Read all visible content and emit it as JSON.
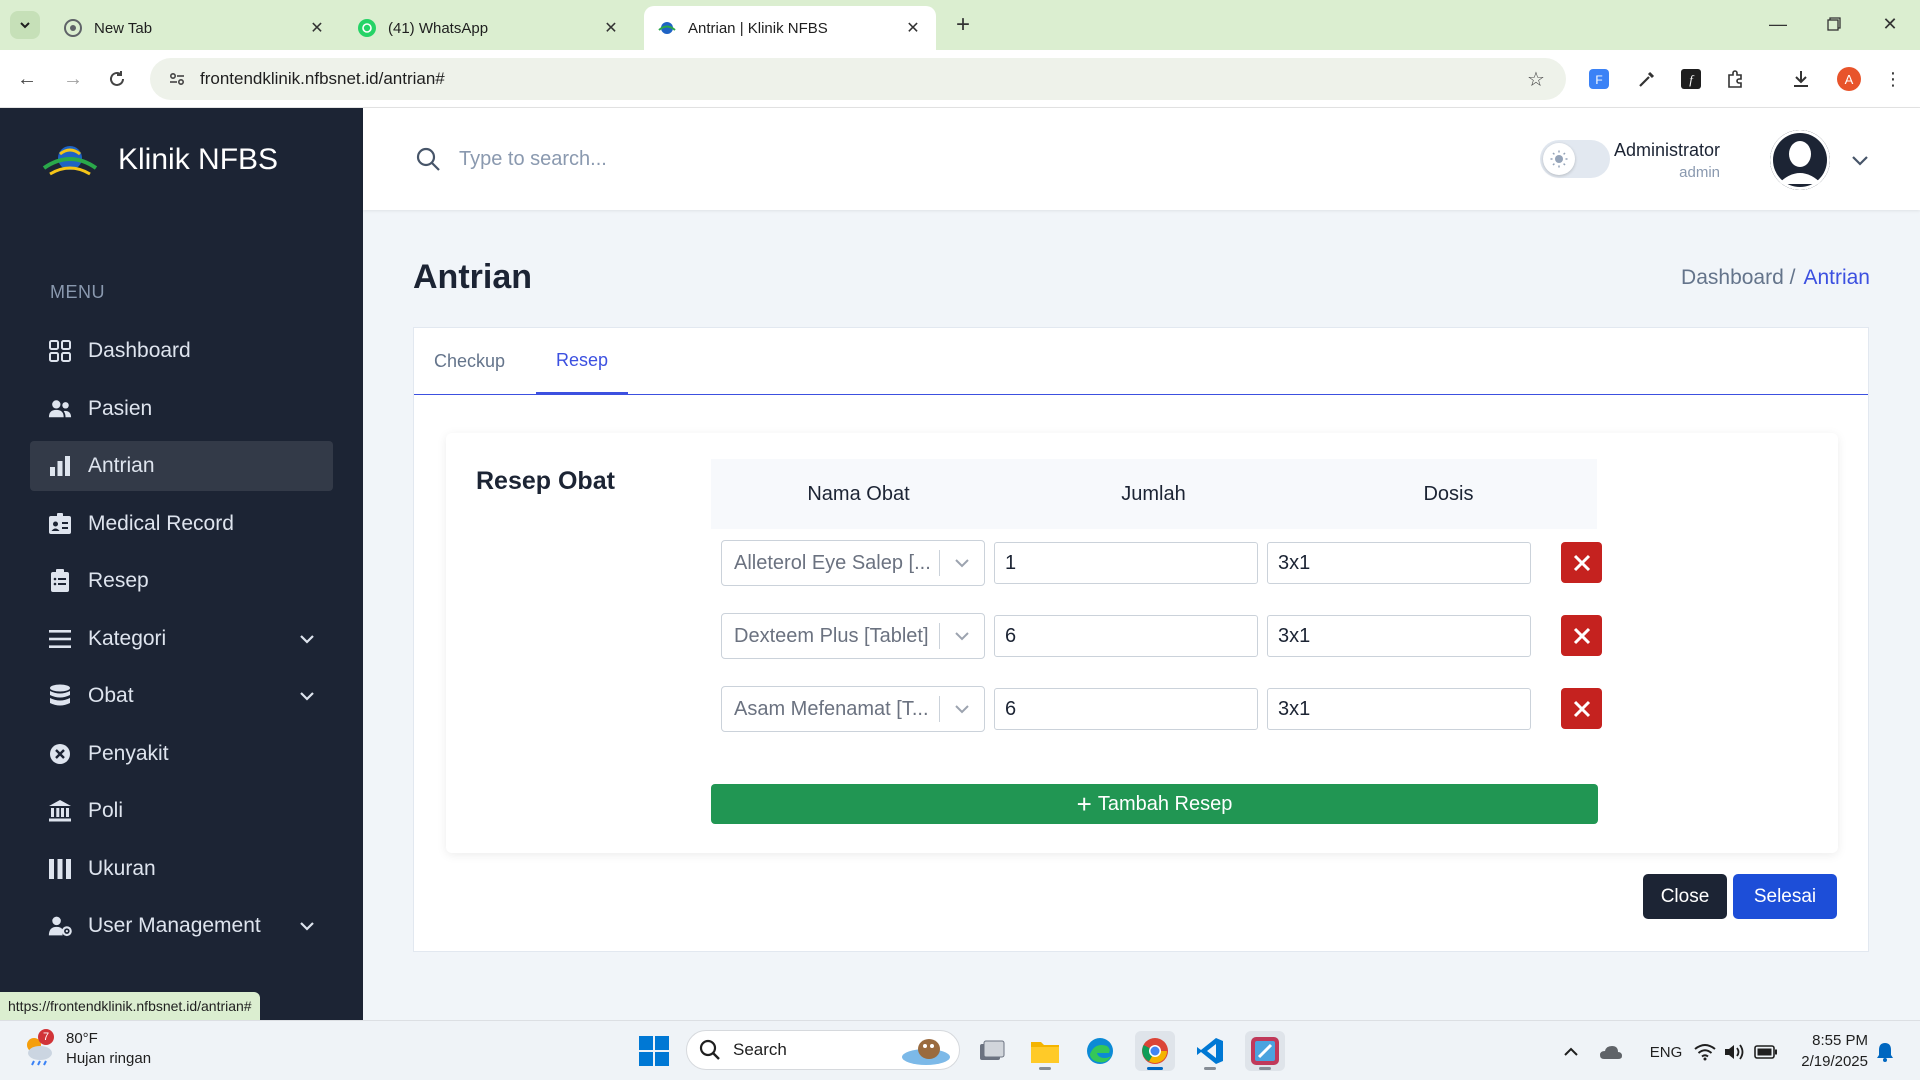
{
  "browser": {
    "tabs": [
      {
        "title": "New Tab",
        "active": false
      },
      {
        "title": "(41) WhatsApp",
        "active": false
      },
      {
        "title": "Antrian | Klinik NFBS",
        "active": true
      }
    ],
    "url": "frontendklinik.nfbsnet.id/antrian#",
    "status_url": "https://frontendklinik.nfbsnet.id/antrian#",
    "profile_initial": "A"
  },
  "sidebar": {
    "brand": "Klinik NFBS",
    "menu_heading": "MENU",
    "items": [
      {
        "label": "Dashboard",
        "icon": "grid-icon",
        "active": false,
        "chevron": false
      },
      {
        "label": "Pasien",
        "icon": "users-icon",
        "active": false,
        "chevron": false
      },
      {
        "label": "Antrian",
        "icon": "bar-chart-icon",
        "active": true,
        "chevron": false
      },
      {
        "label": "Medical Record",
        "icon": "id-card-icon",
        "active": false,
        "chevron": false
      },
      {
        "label": "Resep",
        "icon": "clipboard-icon",
        "active": false,
        "chevron": false
      },
      {
        "label": "Kategori",
        "icon": "list-icon",
        "active": false,
        "chevron": true
      },
      {
        "label": "Obat",
        "icon": "database-icon",
        "active": false,
        "chevron": true
      },
      {
        "label": "Penyakit",
        "icon": "x-circle-icon",
        "active": false,
        "chevron": false
      },
      {
        "label": "Poli",
        "icon": "building-icon",
        "active": false,
        "chevron": false
      },
      {
        "label": "Ukuran",
        "icon": "columns-icon",
        "active": false,
        "chevron": false
      },
      {
        "label": "User Management",
        "icon": "user-gear-icon",
        "active": false,
        "chevron": true
      }
    ]
  },
  "header": {
    "search_placeholder": "Type to search...",
    "user_name": "Administrator",
    "user_role": "admin"
  },
  "page": {
    "title": "Antrian",
    "breadcrumb": {
      "parent": "Dashboard /",
      "current": "Antrian"
    },
    "tabs": [
      {
        "label": "Checkup",
        "active": false
      },
      {
        "label": "Resep",
        "active": true
      }
    ],
    "resep": {
      "title": "Resep Obat",
      "columns": [
        "Nama Obat",
        "Jumlah",
        "Dosis"
      ],
      "rows": [
        {
          "obat": "Alleterol Eye Salep [...",
          "jumlah": "1",
          "dosis": "3x1"
        },
        {
          "obat": "Dexteem Plus [Tablet]",
          "jumlah": "6",
          "dosis": "3x1"
        },
        {
          "obat": "Asam Mefenamat [T...",
          "jumlah": "6",
          "dosis": "3x1"
        }
      ],
      "add_label": "Tambah Resep"
    },
    "close_label": "Close",
    "done_label": "Selesai"
  },
  "taskbar": {
    "weather_temp": "80°F",
    "weather_desc": "Hujan ringan",
    "weather_badge": "7",
    "search_label": "Search",
    "language": "ENG",
    "time": "8:55 PM",
    "date": "2/19/2025"
  },
  "colors": {
    "sidebar_bg": "#1c2434",
    "accent": "#3c50e0",
    "add_button": "#219653",
    "delete_button": "#c5221f",
    "done_button": "#1d4ed8"
  }
}
